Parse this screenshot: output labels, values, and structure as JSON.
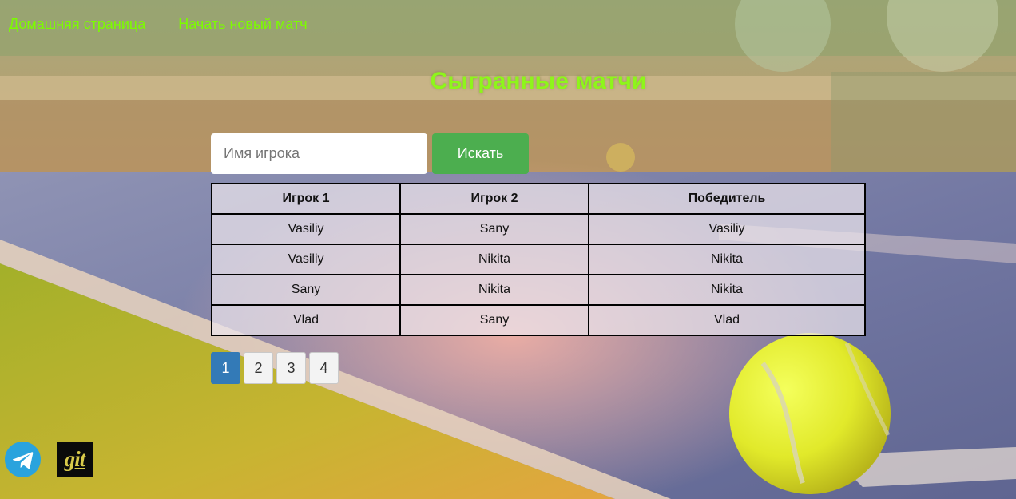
{
  "nav": {
    "home": "Домашняя страница",
    "new_match": "Начать новый матч"
  },
  "page_title": "Сыгранные матчи",
  "search": {
    "placeholder": "Имя игрока",
    "value": "",
    "button_label": "Искать"
  },
  "table": {
    "headers": [
      "Игрок 1",
      "Игрок 2",
      "Победитель"
    ],
    "rows": [
      [
        "Vasiliy",
        "Sany",
        "Vasiliy"
      ],
      [
        "Vasiliy",
        "Nikita",
        "Nikita"
      ],
      [
        "Sany",
        "Nikita",
        "Nikita"
      ],
      [
        "Vlad",
        "Sany",
        "Vlad"
      ]
    ]
  },
  "pagination": {
    "pages": [
      "1",
      "2",
      "3",
      "4"
    ],
    "current": "1"
  },
  "social": {
    "telegram_icon": "telegram-icon",
    "git_label": "git"
  },
  "colors": {
    "nav_link": "#7CFC00",
    "title": "#8ef51b",
    "search_button": "#4cae4f",
    "active_page": "#337ab7",
    "telegram": "#2aa3dd"
  }
}
